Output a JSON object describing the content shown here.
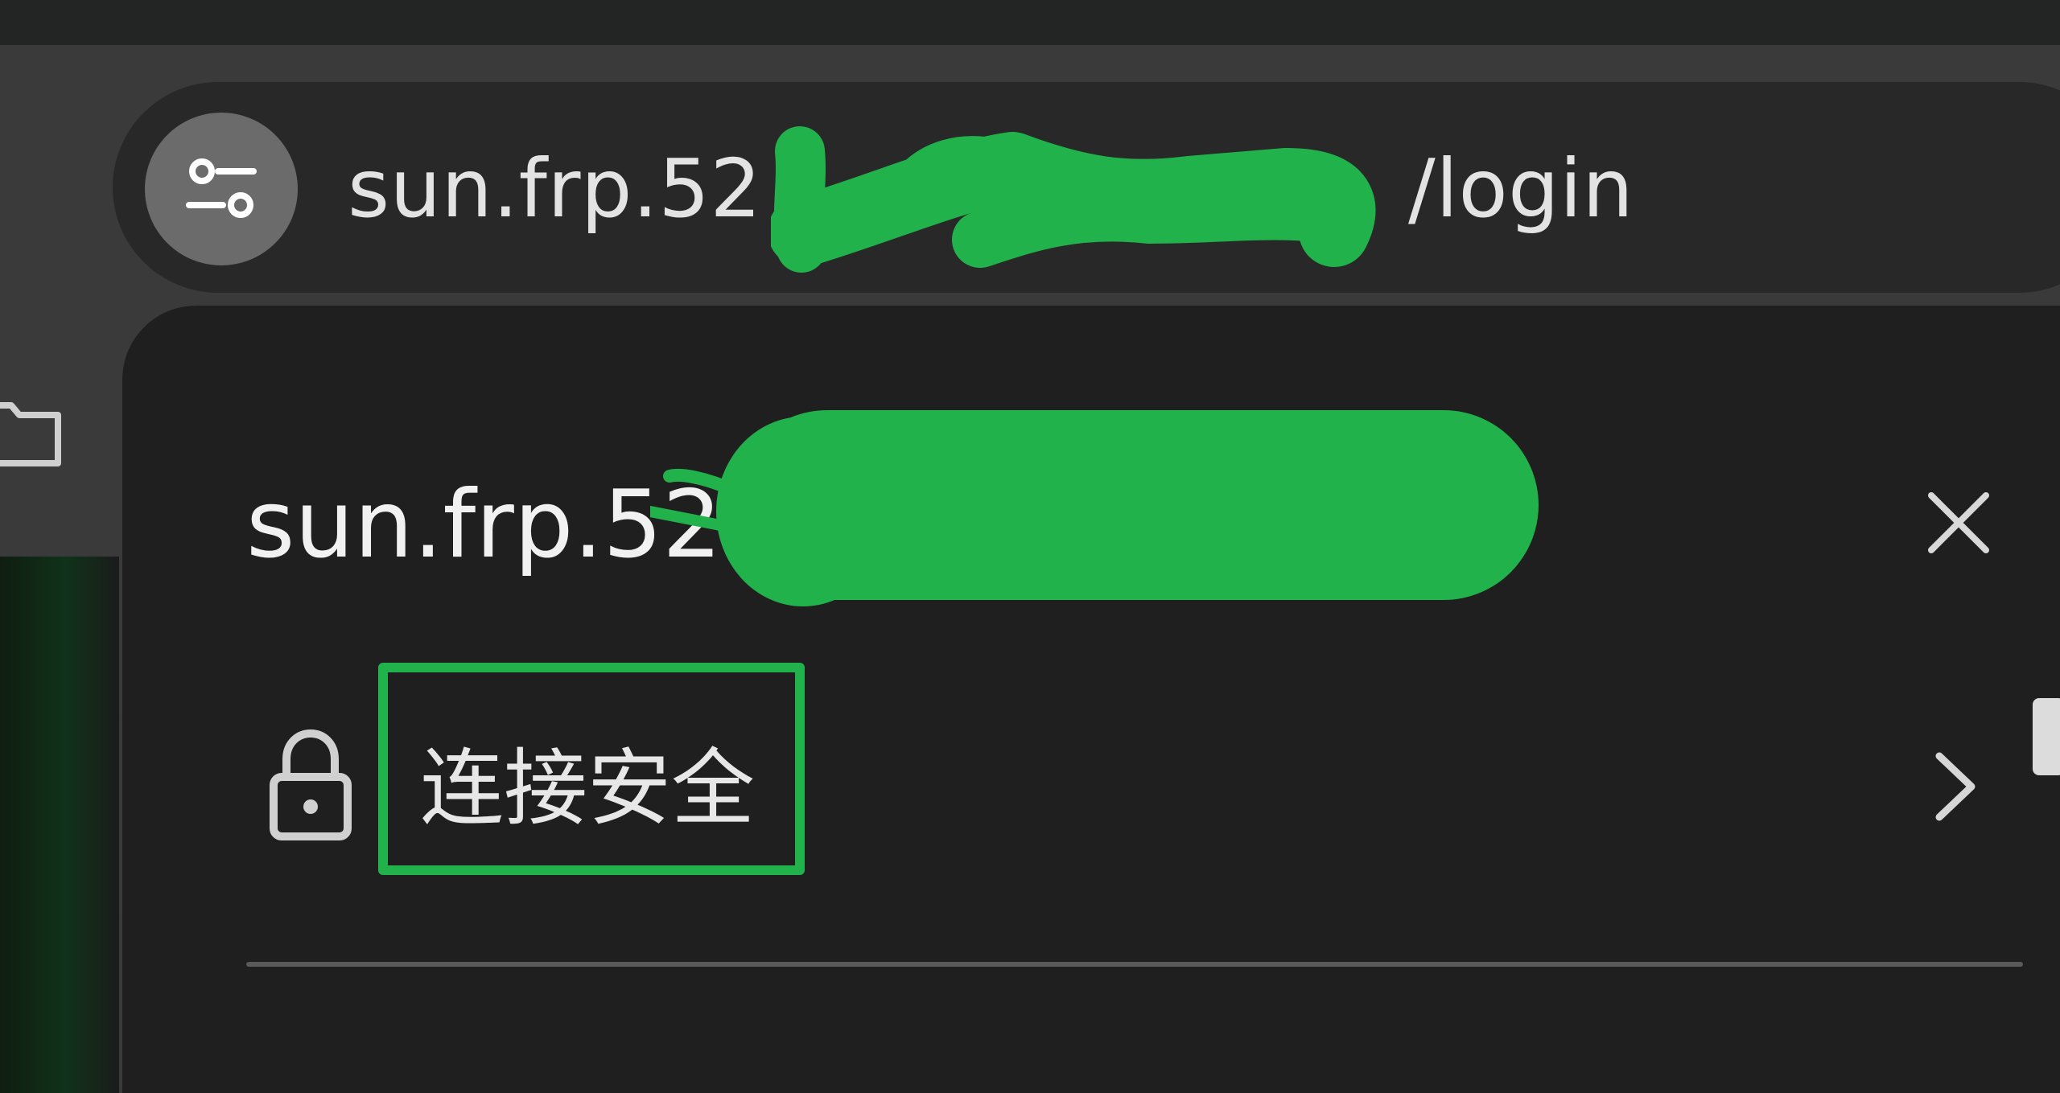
{
  "browser": {
    "address_bar": {
      "url_host": "sun.frp.52",
      "url_path": "/login",
      "site_info_icon": "tune-icon"
    }
  },
  "site_info_popup": {
    "site_title": "sun.frp.52",
    "close_icon": "close-icon",
    "connection": {
      "label": "连接安全",
      "icon": "lock-icon",
      "chevron": "chevron-right-icon"
    }
  },
  "colors": {
    "redaction_green": "#22b24c",
    "popup_background": "#1f1f1f",
    "text_primary": "#e3e3e3",
    "divider": "#5a5a5a"
  }
}
